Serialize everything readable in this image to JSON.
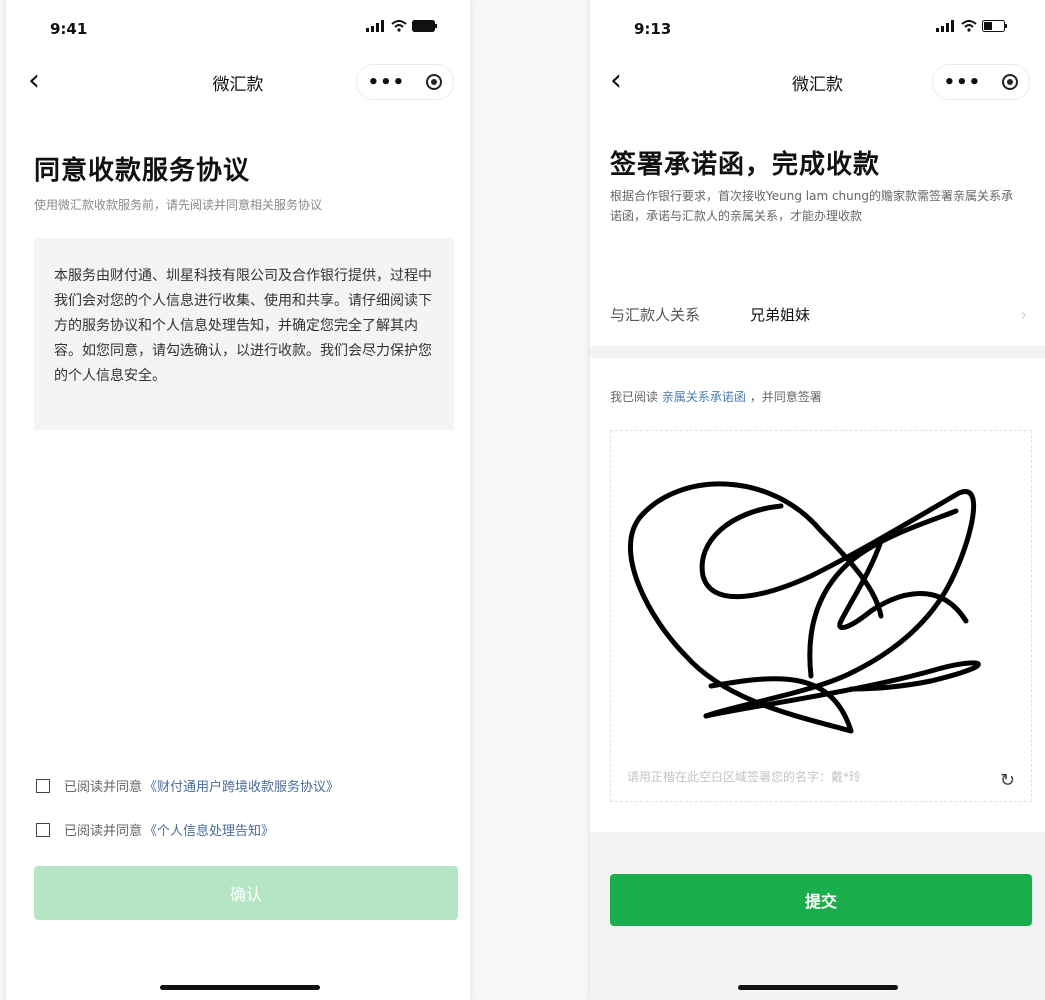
{
  "left_screen": {
    "status_time": "9:41",
    "nav": {
      "back_glyph": "‹",
      "title": "微汇款",
      "more_glyph": "•••"
    },
    "title": "同意收款服务协议",
    "subtitle": "使用微汇款收款服务前，请先阅读并同意相关服务协议",
    "notice_text": "本服务由财付通、圳星科技有限公司及合作银行提供，过程中我们会对您的个人信息进行收集、使用和共享。请仔细阅读下方的服务协议和个人信息处理告知，并确定您完全了解其内容。如您同意，请勾选确认，以进行收款。我们会尽力保护您的个人信息安全。",
    "agreements": [
      {
        "prefix": "已阅读并同意",
        "link": "《财付通用户跨境收款服务协议》"
      },
      {
        "prefix": "已阅读并同意",
        "link": "《个人信息处理告知》"
      }
    ],
    "confirm_label": "确认"
  },
  "right_screen": {
    "status_time": "9:13",
    "nav": {
      "back_glyph": "‹",
      "title": "微汇款",
      "more_glyph": "•••"
    },
    "title": "签署承诺函，完成收款",
    "subtitle": "根据合作银行要求，首次接收Yeung lam chung的赡家款需签署亲属关系承诺函，承诺与汇款人的亲属关系，才能办理收款",
    "relation_label": "与汇款人关系",
    "relation_value": "兄弟姐妹",
    "relation_arrow": "›",
    "read_prefix": "我已阅读",
    "read_link": "亲属关系承诺函",
    "read_suffix": "，并同意签署",
    "sign_hint": "请用正楷在此空白区域签署您的名字：戴*玲",
    "refresh_glyph": "↻",
    "submit_label": "提交"
  },
  "colors": {
    "confirm_disabled": "#b4e6c6",
    "submit_green": "#1aad4b",
    "link_blue": "#4a6c9b"
  },
  "icons": [
    "back-arrow-icon",
    "more-icon",
    "close-miniprogram-icon",
    "signal-icon",
    "wifi-icon",
    "battery-icon",
    "checkbox-icon",
    "chevron-right-icon",
    "refresh-icon"
  ]
}
